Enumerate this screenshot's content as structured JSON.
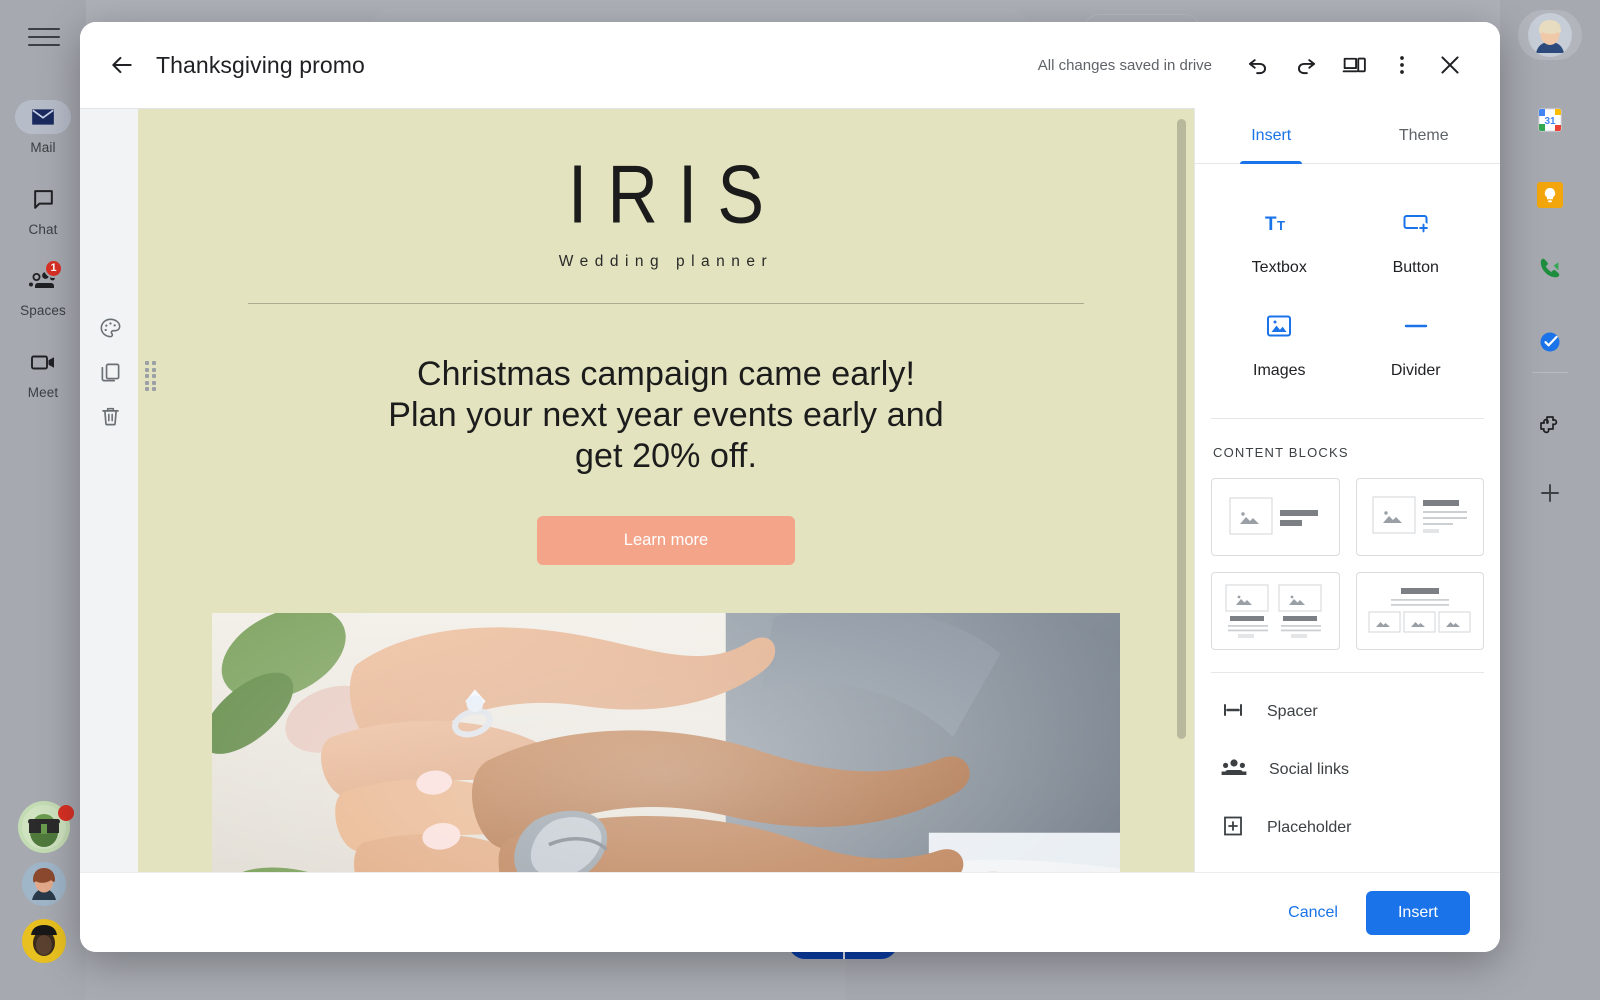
{
  "app": {
    "left_rail": {
      "menu_label": "Main menu",
      "items": [
        {
          "label": "Mail",
          "icon": "mail-icon",
          "active": true,
          "badge": ""
        },
        {
          "label": "Chat",
          "icon": "chat-icon",
          "active": false,
          "badge": ""
        },
        {
          "label": "Spaces",
          "icon": "spaces-icon",
          "active": false,
          "badge": "1"
        },
        {
          "label": "Meet",
          "icon": "meet-icon",
          "active": false,
          "badge": ""
        }
      ],
      "avatars": [
        {
          "name": "contact-avatar-1",
          "status": "online-badge"
        },
        {
          "name": "contact-avatar-2",
          "status": ""
        },
        {
          "name": "contact-avatar-3",
          "status": ""
        }
      ]
    },
    "right_rail": {
      "items": [
        {
          "name": "google-calendar-icon",
          "label": "Calendar"
        },
        {
          "name": "google-keep-icon",
          "label": "Keep"
        },
        {
          "name": "google-voice-icon",
          "label": "Voice"
        },
        {
          "name": "google-tasks-icon",
          "label": "Tasks"
        },
        {
          "name": "add-on-puzzle-icon",
          "label": "Get add-ons"
        },
        {
          "name": "add-icon",
          "label": "Add"
        }
      ],
      "account_avatar_label": "Google Account"
    }
  },
  "modal": {
    "back_label": "Back",
    "title": "Thanksgiving promo",
    "save_status": "All changes saved in drive",
    "header_actions": [
      {
        "name": "undo-icon",
        "label": "Undo"
      },
      {
        "name": "redo-icon",
        "label": "Redo"
      },
      {
        "name": "preview-devices-icon",
        "label": "Preview"
      },
      {
        "name": "more-options-icon",
        "label": "More options"
      },
      {
        "name": "close-icon",
        "label": "Close"
      }
    ],
    "footer": {
      "cancel_label": "Cancel",
      "insert_label": "Insert"
    }
  },
  "block_toolbar": {
    "items": [
      {
        "name": "palette-icon",
        "label": "Style"
      },
      {
        "name": "duplicate-icon",
        "label": "Duplicate"
      },
      {
        "name": "delete-icon",
        "label": "Delete"
      }
    ],
    "drag_handle_label": "Drag block"
  },
  "email": {
    "background_color": "#e3e3bf",
    "logo": {
      "brand": "IRIS",
      "tagline": "Wedding planner"
    },
    "headline_lines": [
      "Christmas campaign came early!",
      "Plan your next year events early and",
      "get 20% off."
    ],
    "cta": {
      "label": "Learn more",
      "color": "#f3a489"
    },
    "image_alt": "wedding-couple-hands-rings-photo"
  },
  "panel": {
    "tabs": [
      {
        "label": "Insert",
        "active": true
      },
      {
        "label": "Theme",
        "active": false
      }
    ],
    "insert_items": [
      {
        "label": "Textbox",
        "icon": "textbox-icon"
      },
      {
        "label": "Button",
        "icon": "button-icon"
      },
      {
        "label": "Images",
        "icon": "image-icon"
      },
      {
        "label": "Divider",
        "icon": "divider-icon"
      }
    ],
    "content_blocks_title": "CONTENT BLOCKS",
    "content_blocks": [
      {
        "name": "block-image-left-short-text"
      },
      {
        "name": "block-image-left-paragraph"
      },
      {
        "name": "block-two-column-image-text"
      },
      {
        "name": "block-heading-three-images"
      }
    ],
    "list_items": [
      {
        "label": "Spacer",
        "icon": "spacer-icon"
      },
      {
        "label": "Social links",
        "icon": "social-links-icon"
      },
      {
        "label": "Placeholder",
        "icon": "placeholder-plus-icon"
      }
    ]
  },
  "colors": {
    "accent_blue": "#1a73e8",
    "email_bg": "#e3e3bf",
    "cta_peach": "#f3a489",
    "badge_red": "#d93025",
    "rail_bg": "#a6a9b0"
  }
}
